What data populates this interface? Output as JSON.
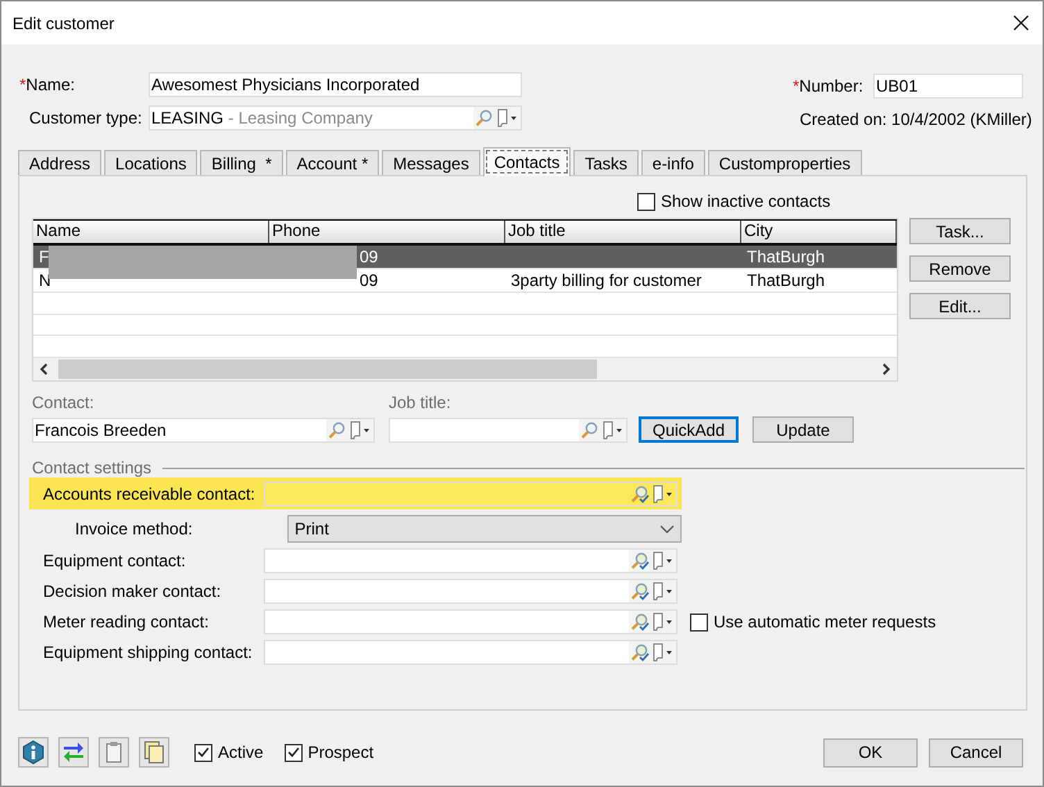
{
  "window": {
    "title": "Edit customer"
  },
  "header": {
    "name": {
      "mark": "*",
      "label": "Name:",
      "value": "Awesomest Physicians Incorporated"
    },
    "customer_type": {
      "label": "Customer type:",
      "code": "LEASING",
      "description": " - Leasing Company"
    },
    "number": {
      "mark": "*",
      "label": "Number:",
      "value": "UB01"
    },
    "created_on": "Created on: 10/4/2002 (KMiller)"
  },
  "tabs": [
    {
      "label": "Address",
      "selected": false
    },
    {
      "label": "Locations",
      "selected": false
    },
    {
      "label": "Billing  *",
      "selected": false
    },
    {
      "label": "Account *",
      "selected": false
    },
    {
      "label": "Messages",
      "selected": false
    },
    {
      "label": "Contacts",
      "selected": true
    },
    {
      "label": "Tasks",
      "selected": false
    },
    {
      "label": "e-info",
      "selected": false
    },
    {
      "label": "Customproperties",
      "selected": false
    }
  ],
  "show_inactive": {
    "label": "Show inactive contacts",
    "checked": false
  },
  "contacts_table": {
    "columns": [
      "Name",
      "Phone",
      "Job title",
      "City"
    ],
    "rows": [
      {
        "cells": [
          "F",
          "09",
          "",
          "ThatBurgh"
        ],
        "selected": true
      },
      {
        "cells": [
          "N",
          "09",
          "3party billing for customer",
          "ThatBurgh"
        ],
        "selected": false
      }
    ]
  },
  "side_buttons": [
    "Task...",
    "Remove",
    "Edit..."
  ],
  "contact": {
    "label": "Contact:",
    "value": "Francois Breeden"
  },
  "job_title": {
    "label": "Job title:"
  },
  "action_buttons": [
    {
      "label": "QuickAdd",
      "default": true
    },
    {
      "label": "Update",
      "default": false
    }
  ],
  "contact_settings": {
    "title": "Contact settings",
    "rows": [
      {
        "kind": "lookup",
        "label": "Accounts receivable contact:",
        "highlighted": true
      },
      {
        "kind": "select",
        "label": "Invoice method:",
        "value": "Print"
      },
      {
        "kind": "lookup",
        "label": "Equipment contact:",
        "highlighted": false
      },
      {
        "kind": "lookup",
        "label": "Decision maker contact:",
        "highlighted": false
      },
      {
        "kind": "lookup",
        "label": "Meter reading contact:",
        "highlighted": false,
        "option": {
          "label": "Use automatic meter requests",
          "checked": false
        }
      },
      {
        "kind": "lookup",
        "label": "Equipment shipping contact:",
        "highlighted": false
      }
    ]
  },
  "footer": {
    "checks": [
      {
        "label": "Active",
        "checked": true
      },
      {
        "label": "Prospect",
        "checked": true
      }
    ],
    "buttons": [
      "OK",
      "Cancel"
    ]
  }
}
